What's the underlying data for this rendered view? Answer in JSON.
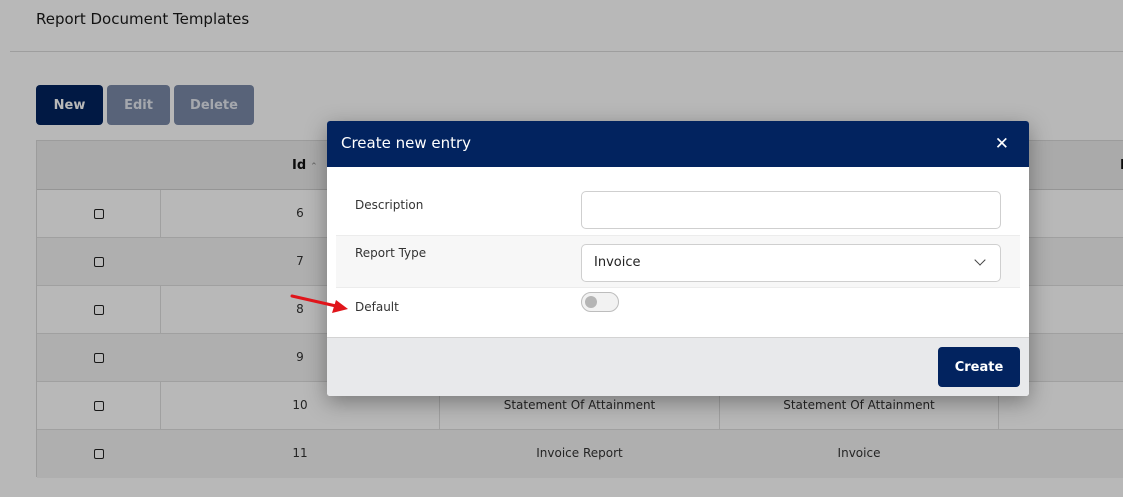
{
  "page": {
    "title": "Report Document Templates"
  },
  "toolbar": {
    "new_label": "New",
    "edit_label": "Edit",
    "delete_label": "Delete"
  },
  "grid": {
    "headers": {
      "id": "Id",
      "fourth_col_partial": "D"
    },
    "rows": [
      {
        "id": "6",
        "description": "",
        "report_type": ""
      },
      {
        "id": "7",
        "description": "",
        "report_type": ""
      },
      {
        "id": "8",
        "description": "",
        "report_type": ""
      },
      {
        "id": "9",
        "description": "",
        "report_type": ""
      },
      {
        "id": "10",
        "description": "Statement Of Attainment",
        "report_type": "Statement Of Attainment"
      },
      {
        "id": "11",
        "description": "Invoice Report",
        "report_type": "Invoice"
      }
    ]
  },
  "modal": {
    "title": "Create new entry",
    "close_icon": "close-icon",
    "description_label": "Description",
    "description_value": "",
    "report_type_label": "Report Type",
    "report_type_value": "Invoice",
    "default_label": "Default",
    "default_checked": false,
    "create_label": "Create"
  },
  "annotation": {
    "arrow_color": "#e0151b",
    "target": "Default"
  },
  "colors": {
    "primary": "#02235f",
    "disabled": "#7b8aa8"
  }
}
